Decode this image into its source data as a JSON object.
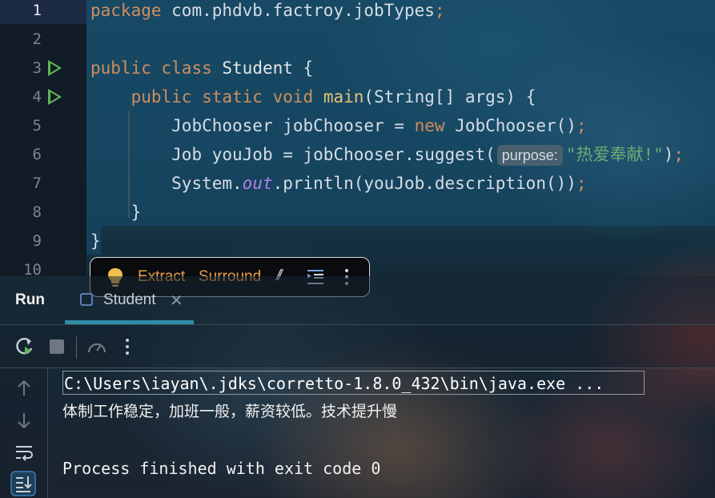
{
  "editor": {
    "line_numbers": [
      "1",
      "2",
      "3",
      "4",
      "5",
      "6",
      "7",
      "8",
      "9",
      "10"
    ],
    "lines": {
      "l1": {
        "kw": "package",
        "rest": " com.phdvb.factroy.jobTypes",
        "semi": ";"
      },
      "l3": {
        "kw1": "public",
        "kw2": "class",
        "name": "Student",
        "brace": " {"
      },
      "l4": {
        "indent": "    ",
        "kw1": "public",
        "kw2": "static",
        "kw3": "void",
        "fn": "main",
        "rest": "(String[] args) {"
      },
      "l5": {
        "indent": "        ",
        "a": "JobChooser jobChooser = ",
        "kw": "new",
        "b": " JobChooser()",
        "semi": ";"
      },
      "l6": {
        "indent": "        ",
        "a": "Job youJob = jobChooser.suggest(",
        "hint": "purpose:",
        "str": "\"热爱奉献!\"",
        "b": ")",
        "semi": ";"
      },
      "l7": {
        "indent": "        ",
        "a": "System.",
        "field": "out",
        "b": ".println(youJob.description())",
        "semi": ";"
      },
      "l8": {
        "text": "    }"
      },
      "l9": {
        "text": "}"
      }
    }
  },
  "popup": {
    "extract_label": "Extract",
    "surround_label": "Surround",
    "comment_glyph": "//"
  },
  "run_window": {
    "title": "Run",
    "tab_label": "Student",
    "tab_close": "✕"
  },
  "console": {
    "command": "C:\\Users\\iayan\\.jdks\\corretto-1.8.0_432\\bin\\java.exe ...",
    "output_line": "体制工作稳定，加班一般，薪资较低。技术提升慢",
    "exit_line": "Process finished with exit code 0"
  },
  "colors": {
    "keyword": "#cf8e5f",
    "function": "#e5c07b",
    "string": "#6aab73",
    "field": "#b77ce8",
    "run_icon": "#5fb85a",
    "accent": "#2f8ca6"
  }
}
